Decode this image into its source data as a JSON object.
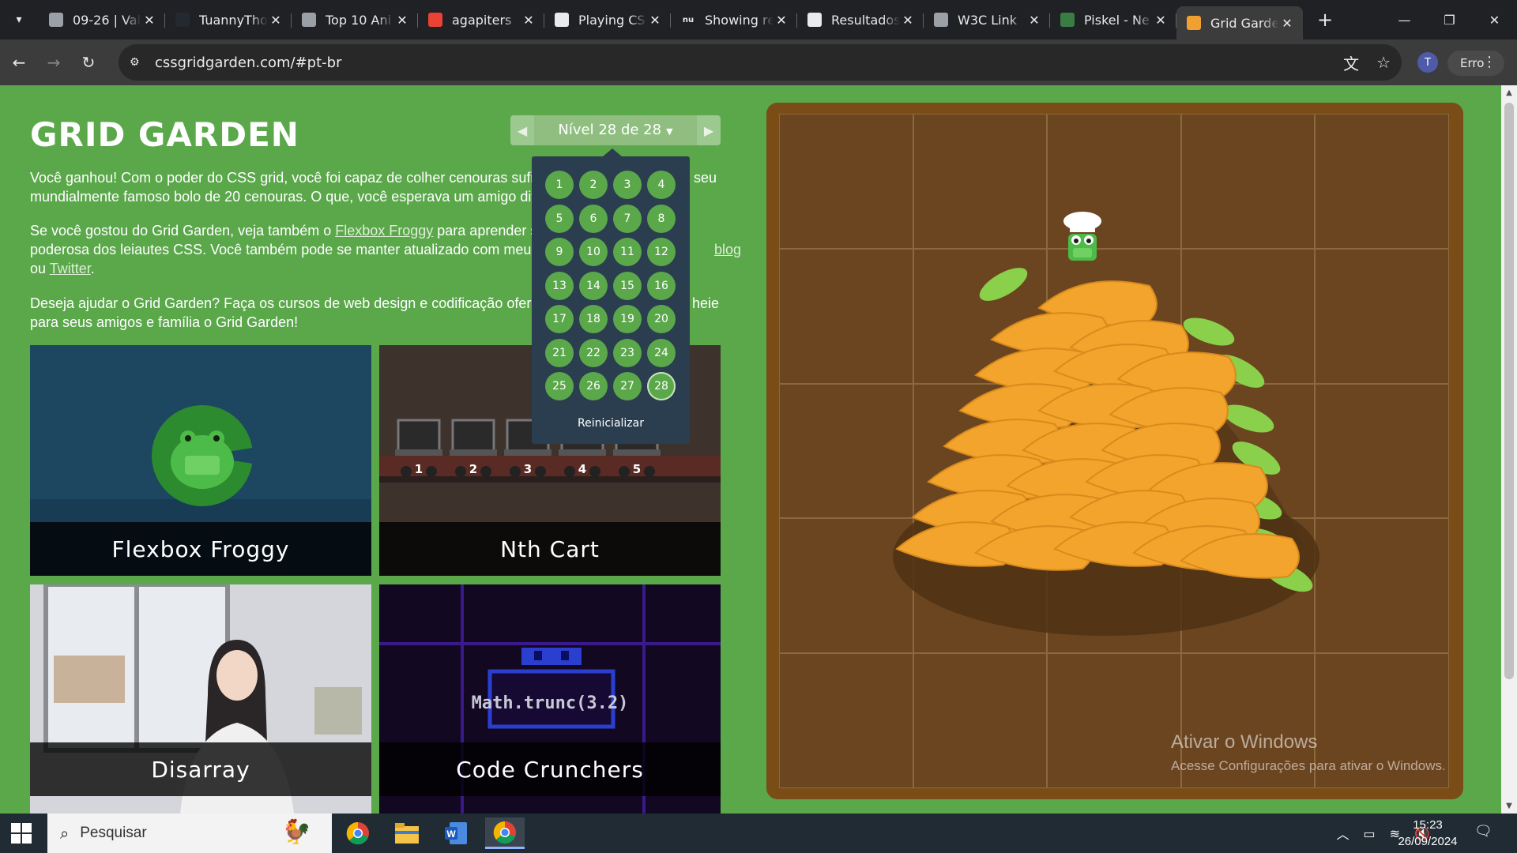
{
  "browser": {
    "tabs": [
      {
        "title": "09-26 | Val",
        "favicon_color": "#9aa0a6"
      },
      {
        "title": "TuannyTho",
        "favicon_color": "#24292f"
      },
      {
        "title": "Top 10 Ani",
        "favicon_color": "#9aa0a6"
      },
      {
        "title": "agapiters",
        "favicon_color": "#ea4335"
      },
      {
        "title": "Playing CS",
        "favicon_color": "#e8eaed"
      },
      {
        "title": "Showing re",
        "favicon_color": "#202124"
      },
      {
        "title": "Resultados",
        "favicon_color": "#e8eaed"
      },
      {
        "title": "W3C Link",
        "favicon_color": "#9aa0a6"
      },
      {
        "title": "Piskel - Ne",
        "favicon_color": "#3a7d44"
      },
      {
        "title": "Grid Garde",
        "favicon_color": "#f0a030",
        "active": true
      }
    ],
    "nu_badge": "nu",
    "url": "cssgridgarden.com/#pt-br",
    "profile_initial": "T",
    "error_button": "Erro"
  },
  "page": {
    "title": "GRID GARDEN",
    "level_label": "Nível 28 de 28",
    "paragraph1": "Você ganhou! Com o poder do CSS grid, você foi capaz de colher cenouras suficientes para o seu mundialmente famoso bolo de 20 cenouras. O que, você esperava um amigo diferente?",
    "paragraph1_visible_start": "Você ganhou! Com o poder do CSS grid, você foi capaz de colher cenouras sufici",
    "paragraph1_visible_end": "seu",
    "paragraph1_line2": "mundialmente famoso bolo de 20 cenouras. O que, você esperava um amigo dife",
    "paragraph2_a": "Se você gostou do Grid Garden, veja também o ",
    "paragraph2_link": "Flexbox Froggy",
    "paragraph2_b": " para aprender so",
    "paragraph2_line2": "poderosa dos leiautes CSS. Você também pode se manter atualizado com meus c",
    "paragraph2_blog": "blog",
    "paragraph2_or": "ou ",
    "paragraph2_twitter": "Twitter",
    "paragraph2_end": ".",
    "paragraph3_line1": "Deseja ajudar o Grid Garden? Faça os cursos de web design e codificação oferec",
    "paragraph3_line1_end": "heie",
    "paragraph3_line2": "para seus amigos e família o Grid Garden!",
    "cards": [
      {
        "label": "Flexbox Froggy"
      },
      {
        "label": "Nth Cart"
      },
      {
        "label": "Disarray"
      },
      {
        "label": "Code Crunchers"
      }
    ],
    "code_text": "Math.trunc(3.2)",
    "cart_numbers": [
      "1",
      "2",
      "3",
      "4",
      "5"
    ],
    "levels": [
      "1",
      "2",
      "3",
      "4",
      "5",
      "6",
      "7",
      "8",
      "9",
      "10",
      "11",
      "12",
      "13",
      "14",
      "15",
      "16",
      "17",
      "18",
      "19",
      "20",
      "21",
      "22",
      "23",
      "24",
      "25",
      "26",
      "27",
      "28"
    ],
    "current_level": 28,
    "reset_label": "Reinicializar",
    "watermark_title": "Ativar o Windows",
    "watermark_sub": "Acesse Configurações para ativar o Windows."
  },
  "taskbar": {
    "search_placeholder": "Pesquisar",
    "time": "15:23",
    "date": "26/09/2024"
  },
  "colors": {
    "page_bg": "#5ba84b",
    "dropdown_bg": "#2b3e4f",
    "soil": "#6b4520",
    "carrot": "#f3a42c",
    "leaf": "#8ad04a"
  }
}
